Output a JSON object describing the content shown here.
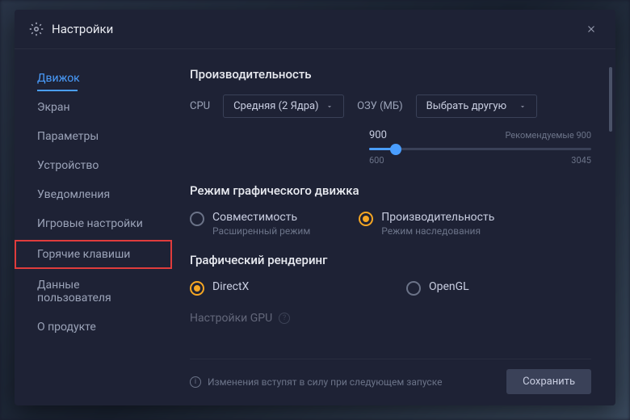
{
  "title": "Настройки",
  "sidebar": [
    "Движок",
    "Экран",
    "Параметры",
    "Устройство",
    "Уведомления",
    "Игровые настройки",
    "Горячие клавиши",
    "Данные пользователя",
    "О продукте"
  ],
  "perf": {
    "title": "Производительность",
    "cpu_label": "CPU",
    "cpu_value": "Средняя (2 Ядра)",
    "ram_label": "ОЗУ (МБ)",
    "ram_value": "Выбрать другую",
    "slider": {
      "value": "900",
      "recommended": "Рекомендуемые 900",
      "min": "600",
      "max": "3045"
    }
  },
  "engine": {
    "title": "Режим графического движка",
    "opt1": {
      "label": "Совместимость",
      "sub": "Расширенный режим"
    },
    "opt2": {
      "label": "Производительность",
      "sub": "Режим наследования"
    }
  },
  "render": {
    "title": "Графический рендеринг",
    "opt1": "DirectX",
    "opt2": "OpenGL"
  },
  "gpu": {
    "title": "Настройки GPU"
  },
  "footer": {
    "notice": "Изменения вступят в силу при следующем запуске",
    "save": "Сохранить"
  }
}
